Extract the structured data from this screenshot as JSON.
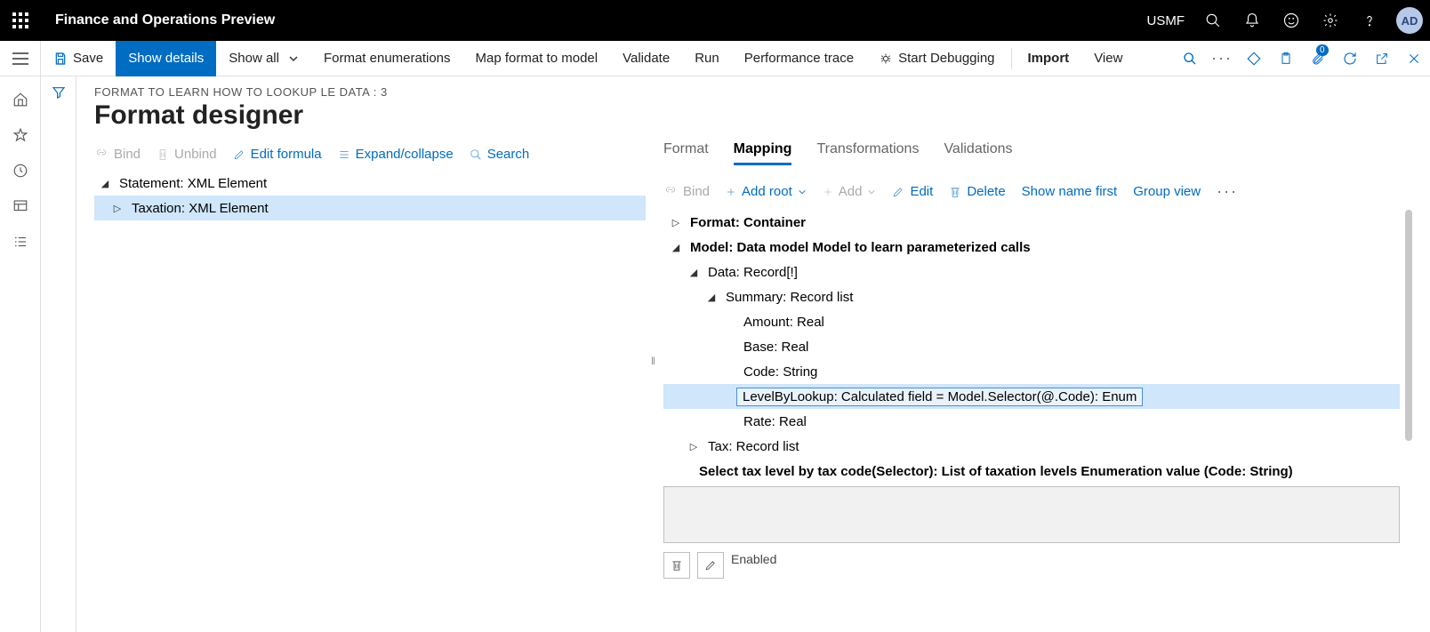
{
  "topbar": {
    "app_title": "Finance and Operations Preview",
    "company": "USMF",
    "avatar": "AD"
  },
  "cmdbar": {
    "save": "Save",
    "show_details": "Show details",
    "show_all": "Show all",
    "format_enum": "Format enumerations",
    "map_format": "Map format to model",
    "validate": "Validate",
    "run": "Run",
    "perf_trace": "Performance trace",
    "start_debug": "Start Debugging",
    "import": "Import",
    "view": "View",
    "badge_count": "0"
  },
  "page": {
    "breadcrumb": "FORMAT TO LEARN HOW TO LOOKUP LE DATA : 3",
    "title": "Format designer"
  },
  "left_toolbar": {
    "bind": "Bind",
    "unbind": "Unbind",
    "edit_formula": "Edit formula",
    "expand": "Expand/collapse",
    "search": "Search"
  },
  "format_tree": {
    "root": "Statement: XML Element",
    "child": "Taxation: XML Element"
  },
  "tabs": {
    "format": "Format",
    "mapping": "Mapping",
    "transformations": "Transformations",
    "validations": "Validations"
  },
  "map_toolbar": {
    "bind": "Bind",
    "add_root": "Add root",
    "add": "Add",
    "edit": "Edit",
    "delete": "Delete",
    "show_name_first": "Show name first",
    "group_view": "Group view"
  },
  "map_tree": {
    "n0": "Format: Container",
    "n1": "Model: Data model Model to learn parameterized calls",
    "n2": "Data: Record[!]",
    "n3": "Summary: Record list",
    "n4": "Amount: Real",
    "n5": "Base: Real",
    "n6": "Code: String",
    "n7": "LevelByLookup: Calculated field = Model.Selector(@.Code): Enum",
    "n8": "Rate: Real",
    "n9": "Tax: Record list",
    "desc": "Select tax level by tax code(Selector): List of taxation levels Enumeration value (Code: String)"
  },
  "footer": {
    "enabled_label": "Enabled"
  }
}
